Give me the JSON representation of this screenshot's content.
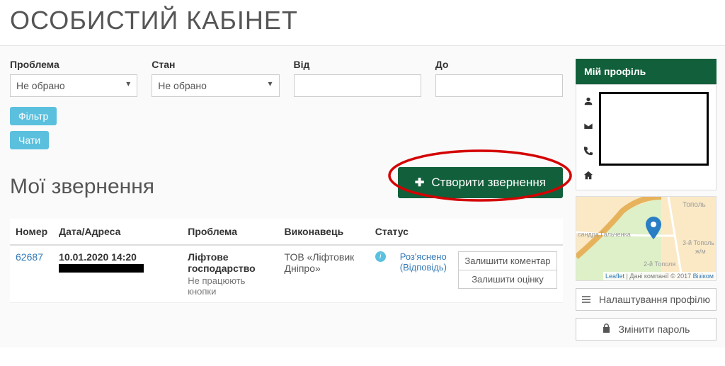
{
  "page": {
    "title": "ОСОБИСТИЙ КАБІНЕТ"
  },
  "filters": {
    "problem": {
      "label": "Проблема",
      "value": "Не обрано"
    },
    "state": {
      "label": "Стан",
      "value": "Не обрано"
    },
    "from": {
      "label": "Від",
      "value": ""
    },
    "to": {
      "label": "До",
      "value": ""
    },
    "filter_btn": "Фільтр",
    "chats_btn": "Чати"
  },
  "requests": {
    "heading": "Мої звернення",
    "create_btn": "Створити звернення",
    "columns": {
      "num": "Номер",
      "date": "Дата/Адреса",
      "problem": "Проблема",
      "executor": "Виконавець",
      "status": "Статус"
    },
    "rows": [
      {
        "num": "62687",
        "date": "10.01.2020 14:20",
        "problem_cat": "Ліфтове господарство",
        "problem_sub": "Не працюють кнопки",
        "executor": "ТОВ «Ліфтовик Дніпро»",
        "status_main": "Роз'яснено",
        "status_sub": "(Відповідь)",
        "action_comment": "Залишити коментар",
        "action_rating": "Залишити оцінку"
      }
    ]
  },
  "sidebar": {
    "profile_title": "Мій профіль",
    "map": {
      "labels": [
        "Тополь",
        "сандра Гальченка",
        "3-й Тополь",
        "ж/м",
        "2-й Тополя"
      ],
      "attr_leaflet": "Leaflet",
      "attr_mid": " | Дані компанії © 2017 ",
      "attr_visicom": "Візіком"
    },
    "settings_btn": "Налаштування профілю",
    "password_btn": "Змінити пароль"
  }
}
